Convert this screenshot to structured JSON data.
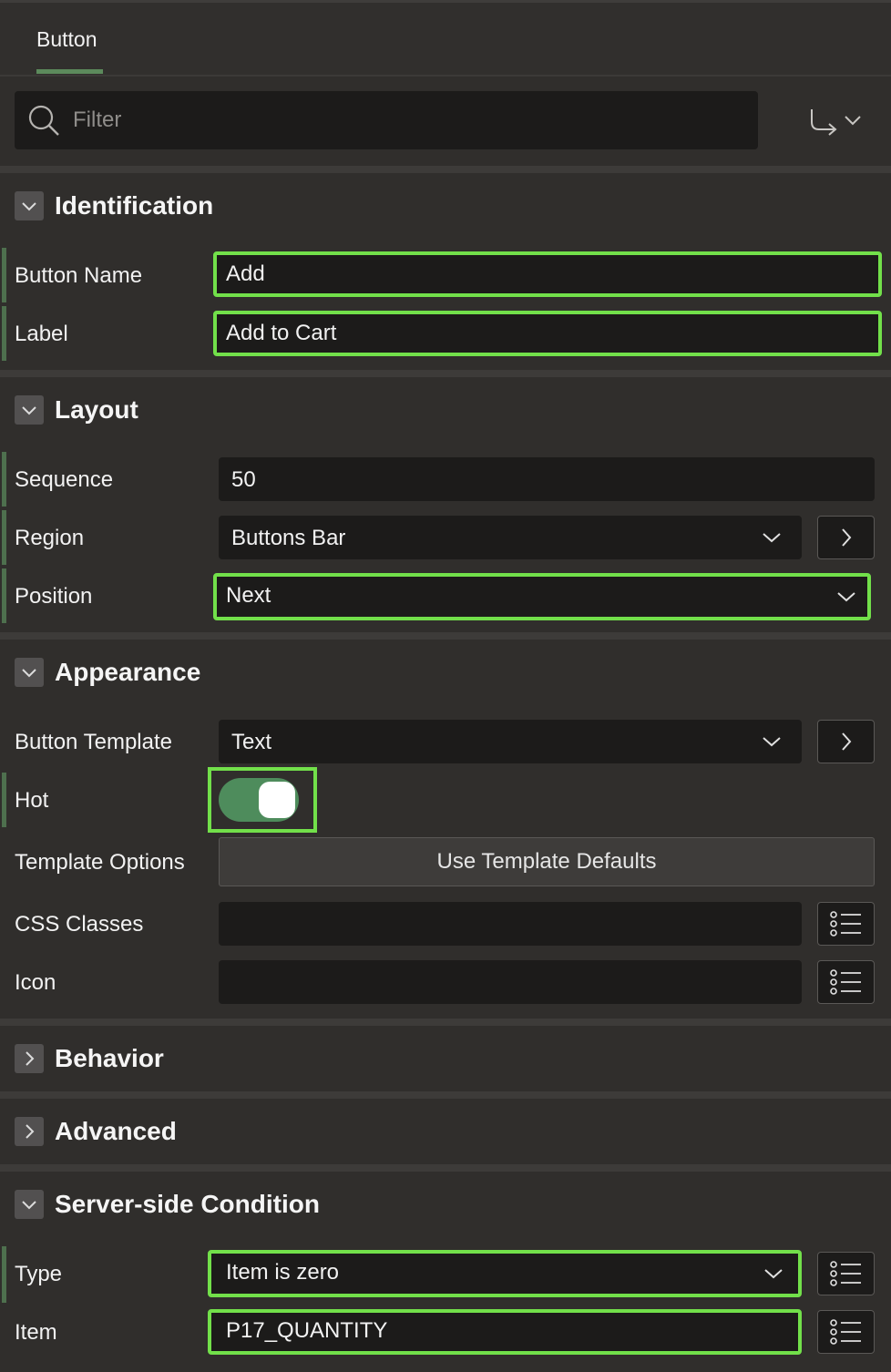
{
  "tab": {
    "label": "Button"
  },
  "filter": {
    "placeholder": "Filter",
    "search_icon": "search-icon",
    "goto_icon": "go-to-group-icon"
  },
  "sections": {
    "identification": {
      "title": "Identification",
      "button_name": {
        "label": "Button Name",
        "value": "Add"
      },
      "label": {
        "label": "Label",
        "value": "Add to Cart"
      }
    },
    "layout": {
      "title": "Layout",
      "sequence": {
        "label": "Sequence",
        "value": "50"
      },
      "region": {
        "label": "Region",
        "value": "Buttons Bar"
      },
      "position": {
        "label": "Position",
        "value": "Next"
      }
    },
    "appearance": {
      "title": "Appearance",
      "button_template": {
        "label": "Button Template",
        "value": "Text"
      },
      "hot": {
        "label": "Hot",
        "value": true
      },
      "template_options": {
        "label": "Template Options",
        "button": "Use Template Defaults"
      },
      "css_classes": {
        "label": "CSS Classes",
        "value": ""
      },
      "icon": {
        "label": "Icon",
        "value": ""
      }
    },
    "behavior": {
      "title": "Behavior",
      "collapsed": true
    },
    "advanced": {
      "title": "Advanced",
      "collapsed": true
    },
    "server_side_condition": {
      "title": "Server-side Condition",
      "type": {
        "label": "Type",
        "value": "Item is zero"
      },
      "item": {
        "label": "Item",
        "value": "P17_QUANTITY"
      }
    }
  },
  "colors": {
    "highlight": "#72e04a",
    "toggle_on": "#4e8c5c",
    "background": "#302e2c",
    "field": "#1c1b1a"
  }
}
